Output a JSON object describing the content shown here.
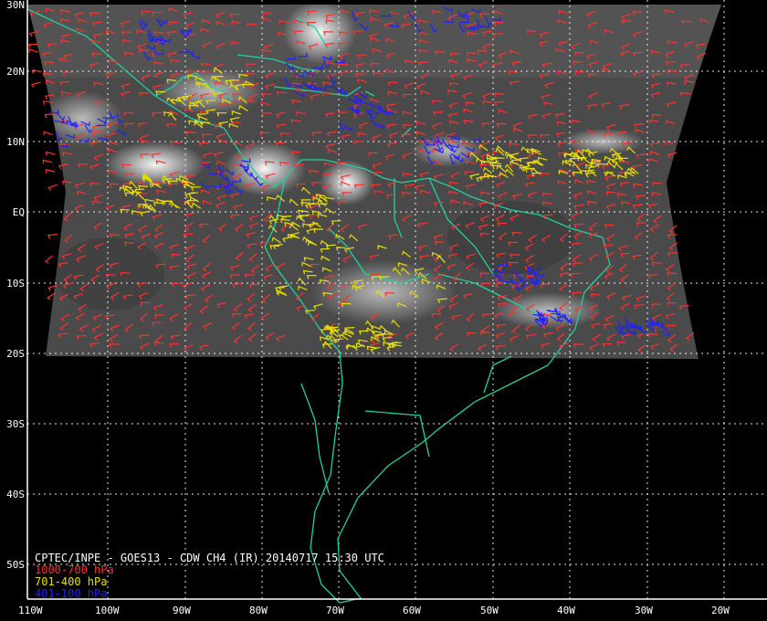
{
  "title": "CPTEC/INPE - GOES13 - CDW CH4 (IR) 20140717 15:30 UTC",
  "legend": [
    {
      "label": "1000-700 hPa",
      "color": "#ff3030"
    },
    {
      "label": "701-400 hPa",
      "color": "#e8e000"
    },
    {
      "label": "401-100 hPa",
      "color": "#2020ff"
    }
  ],
  "lat_labels": [
    "30N",
    "20N",
    "10N",
    "EQ",
    "10S",
    "20S",
    "30S",
    "40S",
    "50S"
  ],
  "lon_labels": [
    "110W",
    "100W",
    "90W",
    "80W",
    "70W",
    "60W",
    "50W",
    "40W",
    "30W",
    "20W"
  ],
  "colors": {
    "coast": "#22d0a0",
    "grid": "#ffffff",
    "background": "#000000"
  }
}
